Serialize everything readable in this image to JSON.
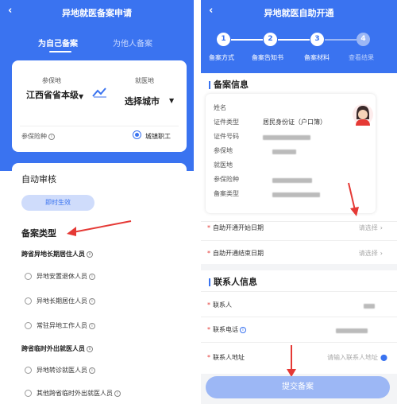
{
  "left": {
    "title": "异地就医备案申请",
    "tabs": [
      "为自己备案",
      "为他人备案"
    ],
    "insured_place_label": "参保地",
    "insured_place_value": "江西省省本级",
    "medical_place_label": "就医地",
    "medical_place_value": "选择城市",
    "insurance_label": "参保险种",
    "insurance_value": "城镇职工",
    "auto_review_title": "自动审核",
    "auto_review_badge": "即时生效",
    "type_title": "备案类型",
    "group1": "跨省异地长期居住人员",
    "group1_items": [
      "异地安置退休人员",
      "异地长期居住人员",
      "常驻异地工作人员"
    ],
    "group2": "跨省临时外出就医人员",
    "group2_items": [
      "异地转诊就医人员",
      "其他跨省临时外出就医人员"
    ]
  },
  "right": {
    "title": "异地就医自助开通",
    "steps": [
      {
        "num": "1",
        "label": "备案方式"
      },
      {
        "num": "2",
        "label": "备案告知书"
      },
      {
        "num": "3",
        "label": "备案材料"
      },
      {
        "num": "4",
        "label": "查看结果"
      }
    ],
    "info_title": "备案信息",
    "info_rows": [
      {
        "label": "姓名",
        "value": ""
      },
      {
        "label": "证件类型",
        "value": "居民身份证（户口簿）"
      },
      {
        "label": "证件号码",
        "value": ""
      },
      {
        "label": "参保地",
        "value": ""
      },
      {
        "label": "就医地",
        "value": ""
      },
      {
        "label": "参保险种",
        "value": ""
      },
      {
        "label": "备案类型",
        "value": ""
      }
    ],
    "start_date_label": "自助开通开始日期",
    "end_date_label": "自助开通结束日期",
    "select_placeholder": "请选择",
    "contact_title": "联系人信息",
    "contact_label": "联系人",
    "phone_label": "联系电话",
    "address_label": "联系人地址",
    "address_placeholder": "请输入联系人地址",
    "submit_label": "提交备案"
  },
  "colors": {
    "primary": "#3a73f0",
    "arrow": "#e53935"
  }
}
